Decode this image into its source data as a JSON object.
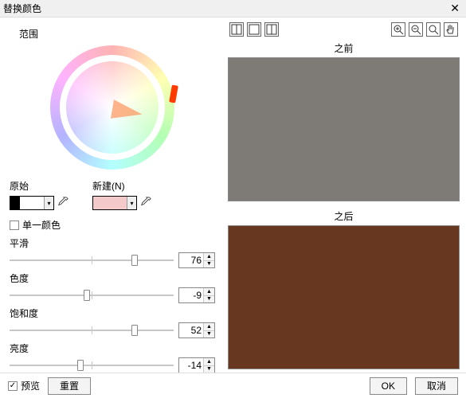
{
  "window": {
    "title": "替换颜色"
  },
  "range_label": "范围",
  "swatches": {
    "original_label": "原始",
    "new_label": "新建(N)",
    "original_color": "#ffffff",
    "new_color": "#f3c9ca"
  },
  "single_color": {
    "label": "单一颜色",
    "checked": false
  },
  "sliders": {
    "smooth": {
      "label": "平滑",
      "value": 76,
      "min": 0,
      "max": 100,
      "pos_pct": 76
    },
    "hue": {
      "label": "色度",
      "value": -9,
      "min": -180,
      "max": 180,
      "pos_pct": 47
    },
    "saturation": {
      "label": "饱和度",
      "value": 52,
      "min": -100,
      "max": 100,
      "pos_pct": 76
    },
    "lightness": {
      "label": "亮度",
      "value": -14,
      "min": -100,
      "max": 100,
      "pos_pct": 43
    }
  },
  "preview": {
    "before_label": "之前",
    "after_label": "之后",
    "before_color": "#7e7b77",
    "after_color": "#67381f"
  },
  "footer": {
    "preview_label": "预览",
    "preview_checked": true,
    "reset_label": "重置",
    "ok_label": "OK",
    "cancel_label": "取消"
  },
  "icons": {
    "close": "✕",
    "check": "✓",
    "up": "▲",
    "down": "▼",
    "dd": "▾"
  }
}
